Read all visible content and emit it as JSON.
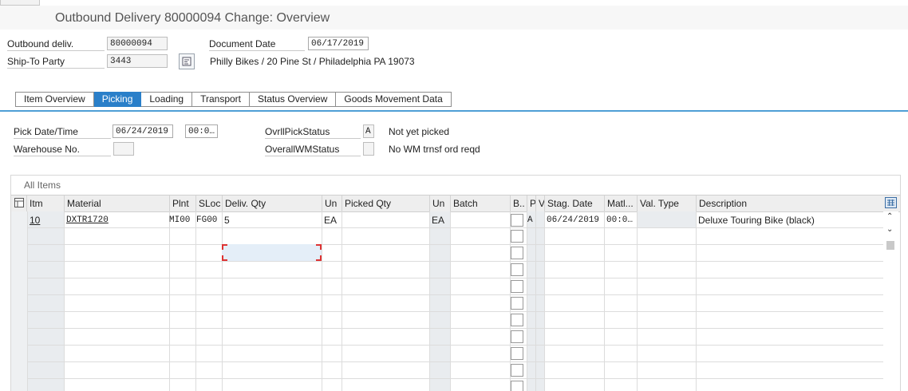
{
  "window": {
    "title": "Outbound Delivery 80000094 Change: Overview"
  },
  "header": {
    "outbound_label": "Outbound deliv.",
    "outbound_value": "80000094",
    "shipto_label": "Ship-To Party",
    "shipto_value": "3443",
    "docdate_label": "Document Date",
    "docdate_value": "06/17/2019",
    "shipto_address": "Philly Bikes / 20 Pine St / Philadelphia PA 19073"
  },
  "tabs": [
    {
      "label": "Item Overview"
    },
    {
      "label": "Picking"
    },
    {
      "label": "Loading"
    },
    {
      "label": "Transport"
    },
    {
      "label": "Status Overview"
    },
    {
      "label": "Goods Movement Data"
    }
  ],
  "picking": {
    "pickdate_label": "Pick Date/Time",
    "pickdate_value": "06/24/2019",
    "picktime_value": "00:0…",
    "warehouse_label": "Warehouse No.",
    "warehouse_value": "",
    "ovrlpick_label": "OvrllPickStatus",
    "ovrlpick_code": "A",
    "ovrlpick_text": "Not yet picked",
    "overallwm_label": "OverallWMStatus",
    "overallwm_code": "",
    "overallwm_text": "No WM trnsf ord reqd"
  },
  "items": {
    "section_title": "All Items",
    "columns": [
      "Itm",
      "Material",
      "Plnt",
      "SLoc",
      "Deliv. Qty",
      "Un",
      "Picked Qty",
      "Un",
      "Batch",
      "B..",
      "P",
      "V",
      "Stag. Date",
      "Matl...",
      "Val. Type",
      "Description"
    ],
    "row1": {
      "itm": "10",
      "material": "DXTR1720",
      "plnt": "MI00",
      "sloc": "FG00",
      "deliv_qty": "5",
      "un": "EA",
      "picked_qty": "",
      "un2": "EA",
      "batch": "",
      "p": "A",
      "v": "",
      "stag_date": "06/24/2019",
      "matl": "00:0…",
      "val_type": "",
      "description": "Deluxe Touring Bike (black)"
    }
  },
  "icons": {
    "partner_detail": "detail-icon",
    "row_select": "select-all-icon",
    "table_settings": "table-settings-icon",
    "scroll_up": "chevron-up-icon",
    "scroll_down": "chevron-down-icon"
  },
  "colors": {
    "active_tab": "#2a7fc9",
    "tab_underline": "#4f9fd6",
    "focus_corner": "#dd3333"
  }
}
